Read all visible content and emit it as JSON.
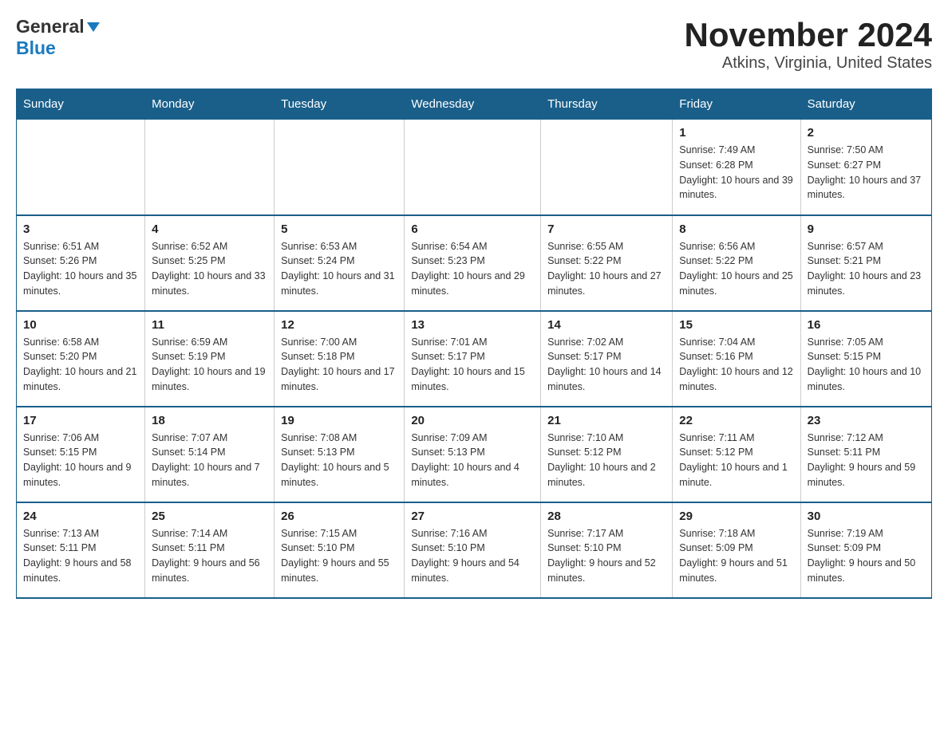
{
  "logo": {
    "general": "General",
    "blue": "Blue"
  },
  "title": "November 2024",
  "subtitle": "Atkins, Virginia, United States",
  "weekdays": [
    "Sunday",
    "Monday",
    "Tuesday",
    "Wednesday",
    "Thursday",
    "Friday",
    "Saturday"
  ],
  "weeks": [
    [
      {
        "day": "",
        "sunrise": "",
        "sunset": "",
        "daylight": ""
      },
      {
        "day": "",
        "sunrise": "",
        "sunset": "",
        "daylight": ""
      },
      {
        "day": "",
        "sunrise": "",
        "sunset": "",
        "daylight": ""
      },
      {
        "day": "",
        "sunrise": "",
        "sunset": "",
        "daylight": ""
      },
      {
        "day": "",
        "sunrise": "",
        "sunset": "",
        "daylight": ""
      },
      {
        "day": "1",
        "sunrise": "Sunrise: 7:49 AM",
        "sunset": "Sunset: 6:28 PM",
        "daylight": "Daylight: 10 hours and 39 minutes."
      },
      {
        "day": "2",
        "sunrise": "Sunrise: 7:50 AM",
        "sunset": "Sunset: 6:27 PM",
        "daylight": "Daylight: 10 hours and 37 minutes."
      }
    ],
    [
      {
        "day": "3",
        "sunrise": "Sunrise: 6:51 AM",
        "sunset": "Sunset: 5:26 PM",
        "daylight": "Daylight: 10 hours and 35 minutes."
      },
      {
        "day": "4",
        "sunrise": "Sunrise: 6:52 AM",
        "sunset": "Sunset: 5:25 PM",
        "daylight": "Daylight: 10 hours and 33 minutes."
      },
      {
        "day": "5",
        "sunrise": "Sunrise: 6:53 AM",
        "sunset": "Sunset: 5:24 PM",
        "daylight": "Daylight: 10 hours and 31 minutes."
      },
      {
        "day": "6",
        "sunrise": "Sunrise: 6:54 AM",
        "sunset": "Sunset: 5:23 PM",
        "daylight": "Daylight: 10 hours and 29 minutes."
      },
      {
        "day": "7",
        "sunrise": "Sunrise: 6:55 AM",
        "sunset": "Sunset: 5:22 PM",
        "daylight": "Daylight: 10 hours and 27 minutes."
      },
      {
        "day": "8",
        "sunrise": "Sunrise: 6:56 AM",
        "sunset": "Sunset: 5:22 PM",
        "daylight": "Daylight: 10 hours and 25 minutes."
      },
      {
        "day": "9",
        "sunrise": "Sunrise: 6:57 AM",
        "sunset": "Sunset: 5:21 PM",
        "daylight": "Daylight: 10 hours and 23 minutes."
      }
    ],
    [
      {
        "day": "10",
        "sunrise": "Sunrise: 6:58 AM",
        "sunset": "Sunset: 5:20 PM",
        "daylight": "Daylight: 10 hours and 21 minutes."
      },
      {
        "day": "11",
        "sunrise": "Sunrise: 6:59 AM",
        "sunset": "Sunset: 5:19 PM",
        "daylight": "Daylight: 10 hours and 19 minutes."
      },
      {
        "day": "12",
        "sunrise": "Sunrise: 7:00 AM",
        "sunset": "Sunset: 5:18 PM",
        "daylight": "Daylight: 10 hours and 17 minutes."
      },
      {
        "day": "13",
        "sunrise": "Sunrise: 7:01 AM",
        "sunset": "Sunset: 5:17 PM",
        "daylight": "Daylight: 10 hours and 15 minutes."
      },
      {
        "day": "14",
        "sunrise": "Sunrise: 7:02 AM",
        "sunset": "Sunset: 5:17 PM",
        "daylight": "Daylight: 10 hours and 14 minutes."
      },
      {
        "day": "15",
        "sunrise": "Sunrise: 7:04 AM",
        "sunset": "Sunset: 5:16 PM",
        "daylight": "Daylight: 10 hours and 12 minutes."
      },
      {
        "day": "16",
        "sunrise": "Sunrise: 7:05 AM",
        "sunset": "Sunset: 5:15 PM",
        "daylight": "Daylight: 10 hours and 10 minutes."
      }
    ],
    [
      {
        "day": "17",
        "sunrise": "Sunrise: 7:06 AM",
        "sunset": "Sunset: 5:15 PM",
        "daylight": "Daylight: 10 hours and 9 minutes."
      },
      {
        "day": "18",
        "sunrise": "Sunrise: 7:07 AM",
        "sunset": "Sunset: 5:14 PM",
        "daylight": "Daylight: 10 hours and 7 minutes."
      },
      {
        "day": "19",
        "sunrise": "Sunrise: 7:08 AM",
        "sunset": "Sunset: 5:13 PM",
        "daylight": "Daylight: 10 hours and 5 minutes."
      },
      {
        "day": "20",
        "sunrise": "Sunrise: 7:09 AM",
        "sunset": "Sunset: 5:13 PM",
        "daylight": "Daylight: 10 hours and 4 minutes."
      },
      {
        "day": "21",
        "sunrise": "Sunrise: 7:10 AM",
        "sunset": "Sunset: 5:12 PM",
        "daylight": "Daylight: 10 hours and 2 minutes."
      },
      {
        "day": "22",
        "sunrise": "Sunrise: 7:11 AM",
        "sunset": "Sunset: 5:12 PM",
        "daylight": "Daylight: 10 hours and 1 minute."
      },
      {
        "day": "23",
        "sunrise": "Sunrise: 7:12 AM",
        "sunset": "Sunset: 5:11 PM",
        "daylight": "Daylight: 9 hours and 59 minutes."
      }
    ],
    [
      {
        "day": "24",
        "sunrise": "Sunrise: 7:13 AM",
        "sunset": "Sunset: 5:11 PM",
        "daylight": "Daylight: 9 hours and 58 minutes."
      },
      {
        "day": "25",
        "sunrise": "Sunrise: 7:14 AM",
        "sunset": "Sunset: 5:11 PM",
        "daylight": "Daylight: 9 hours and 56 minutes."
      },
      {
        "day": "26",
        "sunrise": "Sunrise: 7:15 AM",
        "sunset": "Sunset: 5:10 PM",
        "daylight": "Daylight: 9 hours and 55 minutes."
      },
      {
        "day": "27",
        "sunrise": "Sunrise: 7:16 AM",
        "sunset": "Sunset: 5:10 PM",
        "daylight": "Daylight: 9 hours and 54 minutes."
      },
      {
        "day": "28",
        "sunrise": "Sunrise: 7:17 AM",
        "sunset": "Sunset: 5:10 PM",
        "daylight": "Daylight: 9 hours and 52 minutes."
      },
      {
        "day": "29",
        "sunrise": "Sunrise: 7:18 AM",
        "sunset": "Sunset: 5:09 PM",
        "daylight": "Daylight: 9 hours and 51 minutes."
      },
      {
        "day": "30",
        "sunrise": "Sunrise: 7:19 AM",
        "sunset": "Sunset: 5:09 PM",
        "daylight": "Daylight: 9 hours and 50 minutes."
      }
    ]
  ]
}
